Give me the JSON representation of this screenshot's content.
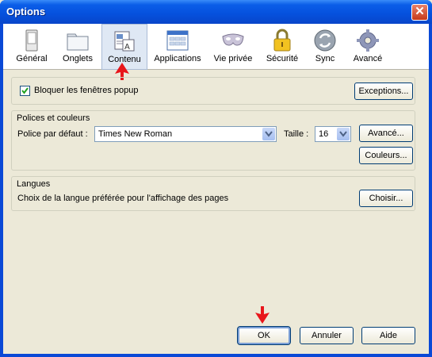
{
  "window": {
    "title": "Options",
    "close_symbol": "✕"
  },
  "toolbar": {
    "items": [
      {
        "label": "Général",
        "icon": "general-icon"
      },
      {
        "label": "Onglets",
        "icon": "tabs-icon"
      },
      {
        "label": "Contenu",
        "icon": "content-icon",
        "selected": true
      },
      {
        "label": "Applications",
        "icon": "applications-icon"
      },
      {
        "label": "Vie privée",
        "icon": "privacy-mask-icon"
      },
      {
        "label": "Sécurité",
        "icon": "padlock-icon"
      },
      {
        "label": "Sync",
        "icon": "sync-icon"
      },
      {
        "label": "Avancé",
        "icon": "gear-icon"
      }
    ]
  },
  "popup": {
    "checkbox_label": "Bloquer les fenêtres popup",
    "checked": true,
    "exceptions_label": "Exceptions..."
  },
  "fonts": {
    "title": "Polices et couleurs",
    "default_font_label": "Police par défaut :",
    "default_font_value": "Times New Roman",
    "size_label": "Taille :",
    "size_value": "16",
    "advanced_label": "Avancé...",
    "colors_label": "Couleurs..."
  },
  "languages": {
    "title": "Langues",
    "description": "Choix de la langue préférée pour l'affichage des pages",
    "choose_label": "Choisir..."
  },
  "buttons": {
    "ok": "OK",
    "cancel": "Annuler",
    "help": "Aide"
  },
  "colors": {
    "title_bar": "#0b5ee8",
    "dialog_bg": "#ece9d8",
    "annotation_arrow": "#e8161b"
  }
}
